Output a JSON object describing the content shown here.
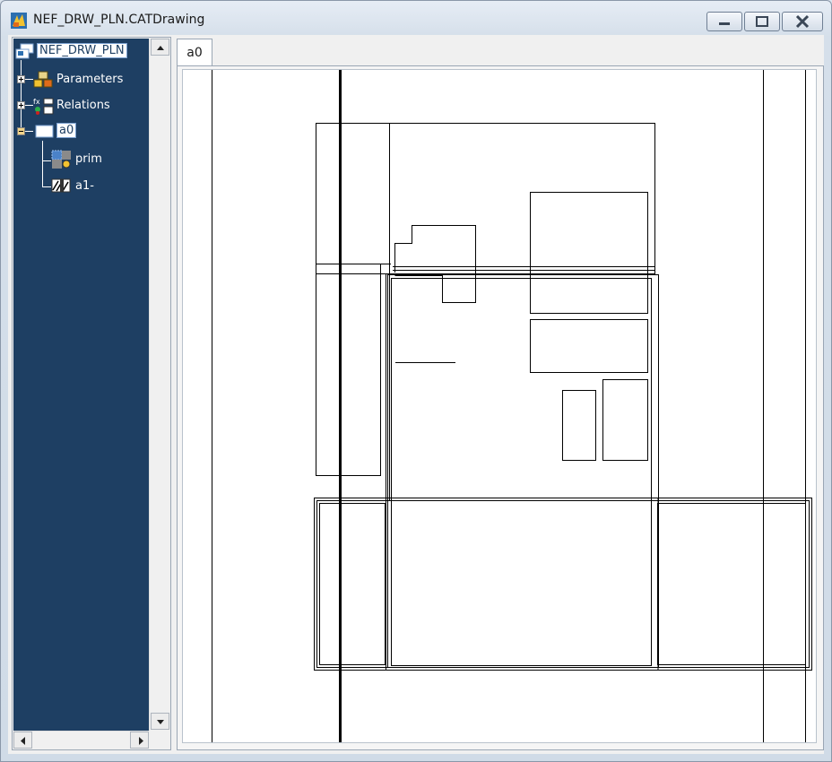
{
  "window": {
    "title": "NEF_DRW_PLN.CATDrawing",
    "icon": "catia-drawing-icon"
  },
  "controls": {
    "minimize": "minimize",
    "maximize": "maximize",
    "close": "close"
  },
  "tree": {
    "root": {
      "label": "NEF_DRW_PLN",
      "icon": "drawing-root-icon"
    },
    "items": [
      {
        "label": "Parameters",
        "icon": "parameters-icon",
        "expander": "+"
      },
      {
        "label": "Relations",
        "icon": "relations-icon",
        "expander": "+"
      },
      {
        "label": "a0",
        "icon": "sheet-icon",
        "expander": "-"
      },
      {
        "label": "prim",
        "icon": "main-view-icon"
      },
      {
        "label": "a1-",
        "icon": "section-view-icon"
      }
    ]
  },
  "tabs": [
    {
      "label": "a0",
      "active": true
    }
  ],
  "colors": {
    "tree_background": "#1e3f63",
    "tree_text": "#ffffff",
    "sheet_background": "#ffffff",
    "drawing_lines": "#000000"
  }
}
